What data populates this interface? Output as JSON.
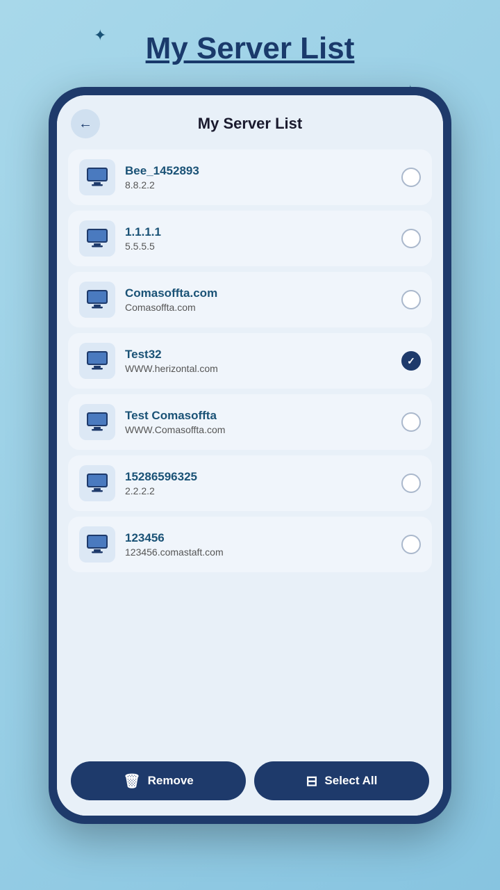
{
  "page": {
    "title": "My Server List",
    "background_color": "#87CEEB"
  },
  "header": {
    "back_label": "←",
    "title": "My Server List"
  },
  "servers": [
    {
      "id": 1,
      "name": "Bee_1452893",
      "ip": "8.8.2.2",
      "checked": false
    },
    {
      "id": 2,
      "name": "1.1.1.1",
      "ip": "5.5.5.5",
      "checked": false
    },
    {
      "id": 3,
      "name": "Comasoffta.com",
      "ip": "Comasoffta.com",
      "checked": false
    },
    {
      "id": 4,
      "name": "Test32",
      "ip": "WWW.herizontal.com",
      "checked": true
    },
    {
      "id": 5,
      "name": "Test Comasoffta",
      "ip": "WWW.Comasoffta.com",
      "checked": false
    },
    {
      "id": 6,
      "name": "15286596325",
      "ip": "2.2.2.2",
      "checked": false
    },
    {
      "id": 7,
      "name": "123456",
      "ip": "123456.comastaft.com",
      "checked": false
    }
  ],
  "buttons": {
    "remove_label": "Remove",
    "select_all_label": "Select All",
    "remove_icon": "🗑",
    "select_all_icon": "⊞"
  },
  "decorations": {
    "stars": [
      "★",
      "✦",
      "✦"
    ]
  }
}
